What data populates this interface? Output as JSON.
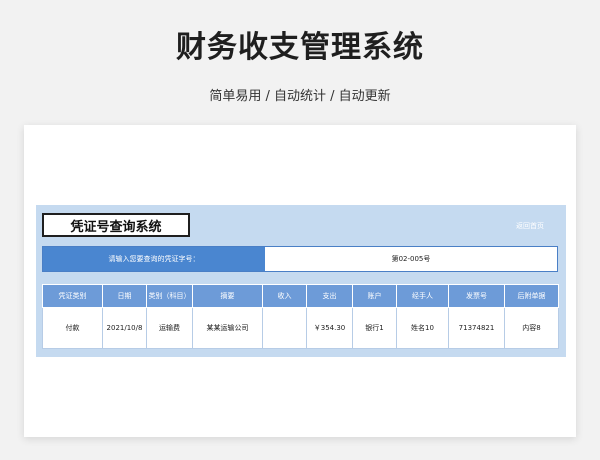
{
  "hero": {
    "title": "财务收支管理系统",
    "subtitle": "简单易用 / 自动统计 / 自动更新"
  },
  "panel": {
    "title": "凭证号查询系统",
    "back_link": "返回首页"
  },
  "query": {
    "label": "请输入您要查询的凭证字号：",
    "value": "第02-005号"
  },
  "table": {
    "headers": [
      "凭证类别",
      "日期",
      "类别（科目）",
      "摘要",
      "收入",
      "支出",
      "账户",
      "经手人",
      "发票号",
      "后附单据"
    ],
    "rows": [
      [
        "付款",
        "2021/10/8",
        "运输费",
        "某某运输公司",
        "",
        "￥354.30",
        "银行1",
        "姓名10",
        "71374821",
        "内容8"
      ]
    ]
  },
  "colors": {
    "panel_bg": "#c5daf0",
    "query_label_bg": "#4a86d0",
    "header_bg": "#6d9bd8"
  }
}
